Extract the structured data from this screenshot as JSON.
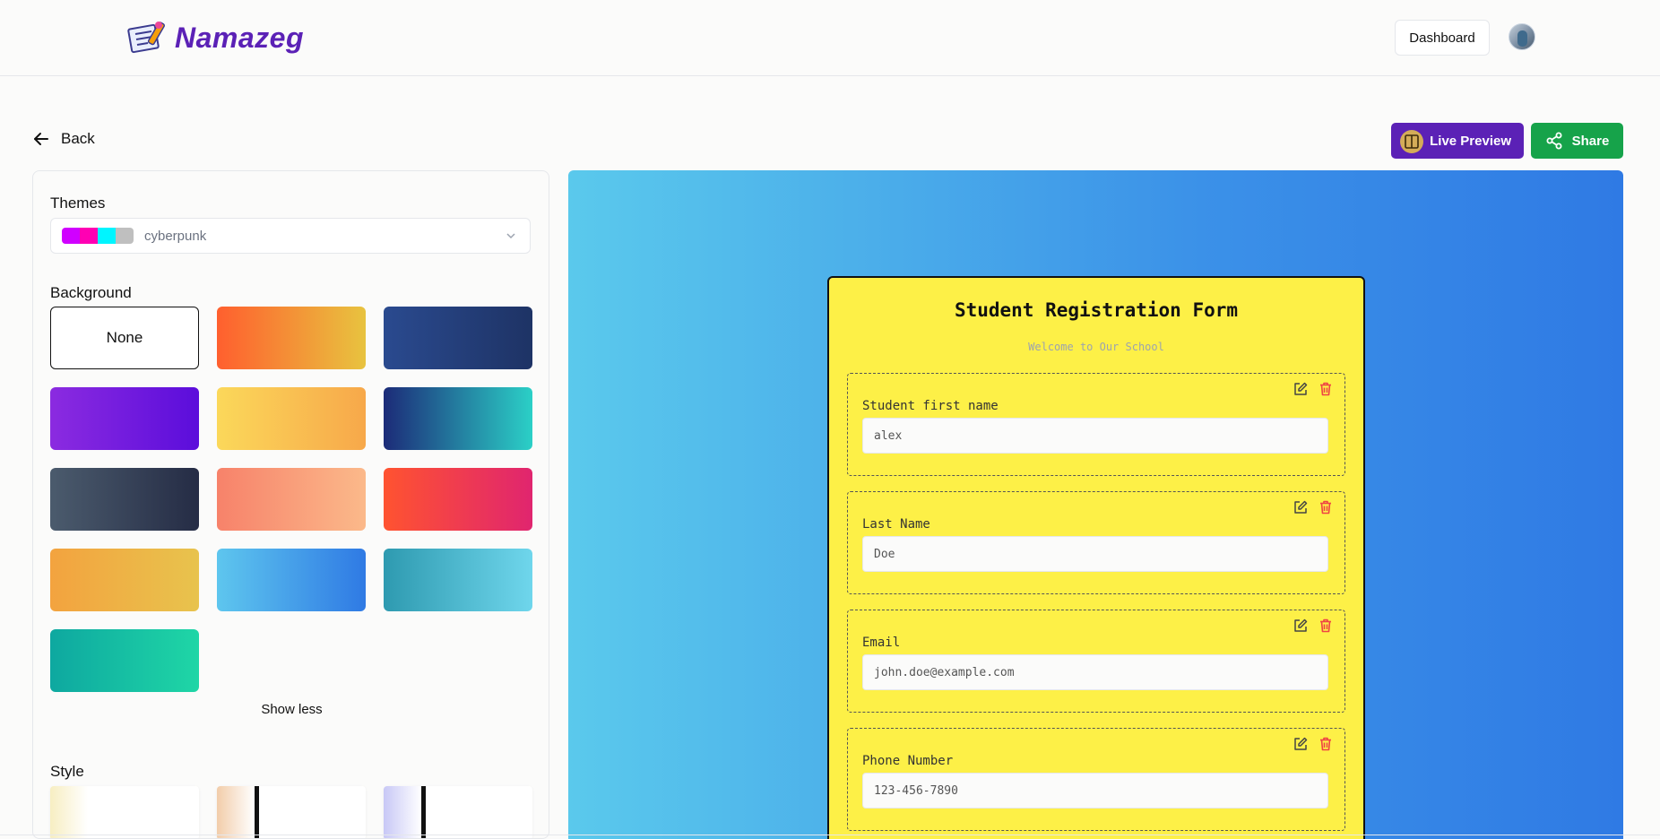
{
  "header": {
    "brand": "Namazeg",
    "dashboard_label": "Dashboard"
  },
  "nav": {
    "back_label": "Back",
    "live_preview_label": "Live Preview",
    "share_label": "Share"
  },
  "panel": {
    "themes_label": "Themes",
    "theme_selected": "cyberpunk",
    "theme_swatch_colors": [
      "#d000ff",
      "#ff00b3",
      "#00f5ff",
      "#bfbfbf"
    ],
    "background_label": "Background",
    "background_none_label": "None",
    "backgrounds": [
      {
        "name": "none"
      },
      {
        "name": "orange-yellow",
        "colors": [
          "#ff5f2e",
          "#e8c33f"
        ]
      },
      {
        "name": "deep-blue",
        "colors": [
          "#2a4a8f",
          "#1e3365"
        ]
      },
      {
        "name": "purple",
        "colors": [
          "#8b2be0",
          "#5b0ddb"
        ]
      },
      {
        "name": "yellow-orange",
        "colors": [
          "#fbd85a",
          "#f7a84a"
        ]
      },
      {
        "name": "navy-teal",
        "colors": [
          "#1c2b78",
          "#2bd0c7"
        ]
      },
      {
        "name": "slate",
        "colors": [
          "#4b5b6d",
          "#252c45"
        ]
      },
      {
        "name": "salmon-peach",
        "colors": [
          "#f7826a",
          "#fbb98a"
        ]
      },
      {
        "name": "red-pink",
        "colors": [
          "#ff5330",
          "#e0256f"
        ]
      },
      {
        "name": "amber",
        "colors": [
          "#f3a33f",
          "#e8c34d"
        ]
      },
      {
        "name": "sky-blue",
        "colors": [
          "#5ec6ee",
          "#2f7ae4"
        ]
      },
      {
        "name": "teal-cyan",
        "colors": [
          "#2e9ab0",
          "#6fd6ec"
        ]
      },
      {
        "name": "teal-green",
        "colors": [
          "#0ea8a0",
          "#1fd6a6"
        ]
      }
    ],
    "show_less_label": "Show less",
    "style_label": "Style",
    "styles": [
      {
        "name": "cream",
        "color": "#f7eec2"
      },
      {
        "name": "peach",
        "color": "#f2cdaa"
      },
      {
        "name": "lavender",
        "color": "#c8c8f6"
      }
    ]
  },
  "form": {
    "title": "Student Registration Form",
    "subtitle": "Welcome to Our School",
    "fields": [
      {
        "label": "Student first name",
        "placeholder": "alex"
      },
      {
        "label": "Last Name",
        "placeholder": "Doe"
      },
      {
        "label": "Email",
        "placeholder": "john.doe@example.com"
      },
      {
        "label": "Phone Number",
        "placeholder": "123-456-7890"
      }
    ]
  },
  "colors": {
    "brand_purple": "#5b21b6",
    "share_green": "#16a34a",
    "form_yellow": "#fdf047",
    "delete_red": "#ef4444"
  }
}
